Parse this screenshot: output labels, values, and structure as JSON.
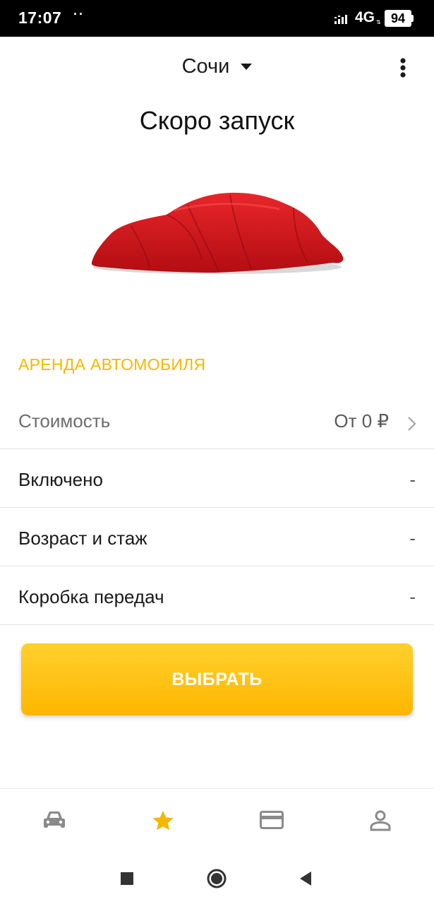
{
  "status_bar": {
    "time": "17:07",
    "dots": "··",
    "network": "4G",
    "battery": "94"
  },
  "header": {
    "city": "Сочи",
    "caret_icon": "caret-down-icon",
    "more_icon": "more-vertical-icon"
  },
  "title": "Скоро запуск",
  "section": {
    "label": "АРЕНДА АВТОМОБИЛЯ"
  },
  "rows": [
    {
      "label": "Стоимость",
      "value": "От 0 ₽",
      "icon": "chevron-right-icon"
    },
    {
      "label": "Включено",
      "value": "-"
    },
    {
      "label": "Возраст и стаж",
      "value": "-"
    },
    {
      "label": "Коробка передач",
      "value": "-"
    }
  ],
  "select_button": {
    "label": "ВЫБРАТЬ"
  },
  "bottom_nav": {
    "items": [
      {
        "icon": "car-icon",
        "active": false
      },
      {
        "icon": "star-icon",
        "active": true
      },
      {
        "icon": "credit-card-icon",
        "active": false
      },
      {
        "icon": "profile-icon",
        "active": false
      }
    ]
  },
  "colors": {
    "accent": "#f5b800",
    "button_top": "#ffd02e",
    "button_bottom": "#ffb600",
    "car_cover": "#d8141a",
    "inactive_icon": "#8a8a8a"
  }
}
